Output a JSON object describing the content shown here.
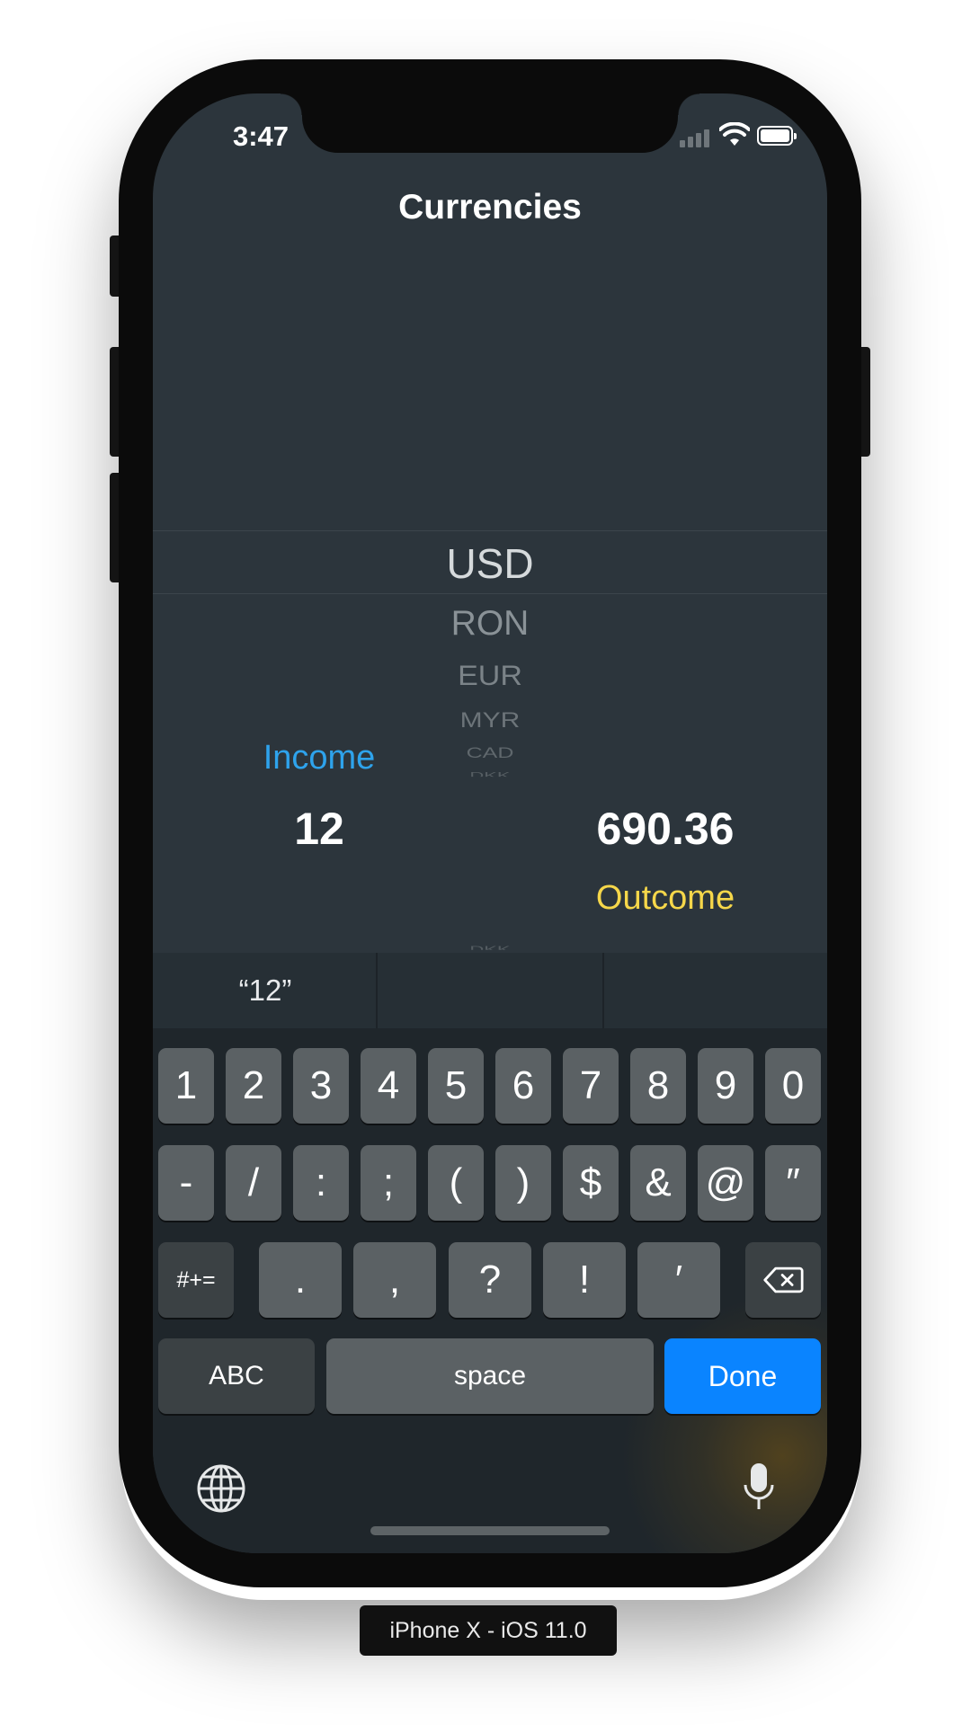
{
  "status_bar": {
    "time": "3:47"
  },
  "nav": {
    "title": "Currencies"
  },
  "picker": {
    "selected": "USD",
    "items": [
      "RON",
      "EUR",
      "MYR",
      "CAD",
      "DKK"
    ]
  },
  "income": {
    "label": "Income",
    "value": "12"
  },
  "outcome": {
    "value": "690.36",
    "label": "Outcome"
  },
  "keyboard": {
    "suggestions": [
      "“12”",
      "",
      ""
    ],
    "row1": [
      "1",
      "2",
      "3",
      "4",
      "5",
      "6",
      "7",
      "8",
      "9",
      "0"
    ],
    "row2": [
      "-",
      "/",
      ":",
      ";",
      "(",
      ")",
      "$",
      "&",
      "@",
      "″"
    ],
    "row3": [
      ".",
      ",",
      "?",
      "!",
      "′"
    ],
    "more_symbols_label": "#+=",
    "abc_label": "ABC",
    "space_label": "space",
    "done_label": "Done"
  },
  "caption": "iPhone X - iOS 11.0",
  "colors": {
    "background": "#2c353c",
    "income_accent": "#2ea3ec",
    "outcome_accent": "#f6d74a",
    "done_button": "#0a84ff"
  },
  "icons": [
    "globe-icon",
    "microphone-icon",
    "backspace-icon",
    "wifi-icon",
    "cellular-signal-icon",
    "battery-icon"
  ]
}
